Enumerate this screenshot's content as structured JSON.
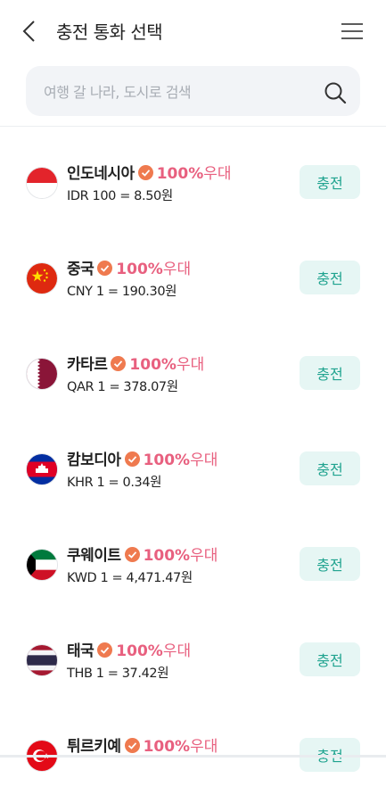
{
  "header": {
    "title": "충전 통화 선택"
  },
  "search": {
    "placeholder": "여행 갈 나라, 도시로 검색"
  },
  "currencies": [
    {
      "country": "인도네시아",
      "pct": "100%",
      "benefit": "우대",
      "rate": "IDR 100 = 8.50원",
      "button": "충전",
      "flag": "indonesia-flag-icon"
    },
    {
      "country": "중국",
      "pct": "100%",
      "benefit": "우대",
      "rate": "CNY 1 = 190.30원",
      "button": "충전",
      "flag": "china-flag-icon"
    },
    {
      "country": "카타르",
      "pct": "100%",
      "benefit": "우대",
      "rate": "QAR 1 = 378.07원",
      "button": "충전",
      "flag": "qatar-flag-icon"
    },
    {
      "country": "캄보디아",
      "pct": "100%",
      "benefit": "우대",
      "rate": "KHR 1 = 0.34원",
      "button": "충전",
      "flag": "cambodia-flag-icon"
    },
    {
      "country": "쿠웨이트",
      "pct": "100%",
      "benefit": "우대",
      "rate": "KWD 1 = 4,471.47원",
      "button": "충전",
      "flag": "kuwait-flag-icon"
    },
    {
      "country": "태국",
      "pct": "100%",
      "benefit": "우대",
      "rate": "THB 1 = 37.42원",
      "button": "충전",
      "flag": "thailand-flag-icon"
    },
    {
      "country": "튀르키예",
      "pct": "100%",
      "benefit": "우대",
      "rate": "",
      "button": "충전",
      "flag": "turkey-flag-icon"
    }
  ],
  "colors": {
    "accent_pink": "#e8607f",
    "button_bg": "#e6f6f4",
    "button_text": "#1fa38f",
    "badge": "#ef7a4f"
  }
}
